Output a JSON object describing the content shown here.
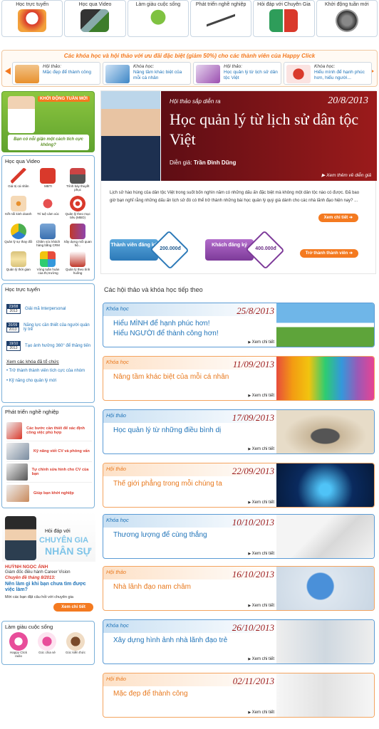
{
  "topnav": [
    {
      "label": "Học trực tuyến",
      "icon": "elearning-icon",
      "color": "#d9392b"
    },
    {
      "label": "Học qua Video",
      "icon": "video-icon",
      "color": "#6b7f8c"
    },
    {
      "label": "Làm giàu cuộc sống",
      "icon": "plant-icon",
      "color": "#6bb23a"
    },
    {
      "label": "Phát triển nghề nghiệp",
      "icon": "stairs-icon",
      "color": "#888888"
    },
    {
      "label": "Hỏi đáp với Chuyên Gia",
      "icon": "qa-icon",
      "color": "#2e9d5a"
    },
    {
      "label": "Khởi động tuần mới",
      "icon": "start-button-icon",
      "color": "#555555"
    }
  ],
  "promo": {
    "heading": "Các khóa học và hội thảo với ưu đãi đặc biệt (giảm 50%) cho các thành viên của Happy Click",
    "items": [
      {
        "type": "Hội thảo:",
        "desc": "Mặc đẹp để thành công",
        "color": "#e8902d"
      },
      {
        "type": "Khóa học:",
        "desc": "Nâng tầm khác biệt của mỗi cá nhân",
        "color": "#3d86c6"
      },
      {
        "type": "Hội thảo:",
        "desc": "Học quản lý từ lịch sử dân tộc Việt",
        "color": "#9b4fb0"
      },
      {
        "type": "Khóa học:",
        "desc": "Hiểu mình để hạnh phúc hơn, hiểu người...",
        "color": "#d9392b"
      }
    ]
  },
  "weekstart": {
    "label": "KHỞI ĐỘNG TUẦN MỚI",
    "text": "Bạn có nỗi giận một cách tích cực không?"
  },
  "video": {
    "title": "Học qua Video",
    "items": [
      "Giá trị cá nhân",
      "MBTI",
      "Trình bày thuyết phục",
      "Kết nối kinh doanh",
      "Trí tuệ cảm xúc",
      "Quản lý theo mục tiêu (MBO)",
      "Quản lý sự thay đổi",
      "Chăm sóc khách hàng bằng CRM",
      "Xây dựng mối quan hệ...",
      "Quản lý thời gian",
      "Vòng tuần hoàn của thị trường",
      "Quản lý theo tình huống"
    ]
  },
  "online": {
    "title": "Học trực tuyến",
    "items": [
      {
        "date": "23/08",
        "year": "2013",
        "text": "Giải mã Interpersonal"
      },
      {
        "date": "20/09",
        "year": "2013",
        "text": "Năng lực cần thiết của người quản lý trẻ"
      },
      {
        "date": "19/10",
        "year": "2013",
        "text": "Tạo ảnh hưởng 360° để thăng tiến"
      }
    ],
    "organized_title": "Xem các khóa đã tổ chức",
    "organized": [
      "Trở thành thành viên tích cực của nhóm",
      "Kỹ năng cho quản lý mới"
    ]
  },
  "career": {
    "title": "Phát triển nghề nghiệp",
    "items": [
      "Các bước cần thiết để xác định công việc phù hợp",
      "Kỹ năng viết CV và phỏng vấn",
      "Tự chỉnh sửa hình cho CV của bạn",
      "Giúp bạn khởi nghiệp"
    ]
  },
  "expert": {
    "ask": "Hỏi đáp với",
    "big1": "CHUYÊN GIA",
    "big2": "NHÂN SỰ",
    "name": "HUỲNH NGỌC ÁNH",
    "role": "Giám đốc điều hành Career Vision",
    "topic_label": "Chuyên đề tháng 8/2013:",
    "topic": "Nên làm gì khi bạn chưa tìm được việc làm?",
    "invite": "Mời các bạn đặt câu hỏi với chuyên gia",
    "button": "Xem chi tiết"
  },
  "life": {
    "title": "Làm giàu cuộc sống",
    "items": [
      "Happy Click radio",
      "Góc chia sẻ",
      "Góc kiến thức"
    ]
  },
  "hero": {
    "label": "Hội thảo sắp diễn ra",
    "date": "20/8/2013",
    "title": "Học quản lý từ lịch sử dân tộc Việt",
    "speaker_label": "Diễn giả:",
    "speaker": "Trần Đình Dũng",
    "more": "Xem thêm về diễn giả",
    "desc": "Lịch sử hào hùng của dân tộc Việt trong suốt bốn nghìn năm có những dấu ấn đặc biệt mà không một dân tộc nào có được. Đã bao giờ bạn nghĩ rằng những dấu ấn lịch sử đó có thể trở thành những bài học quản lý quý giá dành cho các nhà lãnh đạo hiện nay? ...",
    "detail": "Xem chi tiết",
    "member_label": "Thành viên đăng ký",
    "member_price": "200.000đ",
    "guest_label": "Khách đăng ký",
    "guest_price": "400.000đ",
    "join": "Trở thành thành viên"
  },
  "upcoming_title": "Các hội thảo và khóa học tiếp theo",
  "events": [
    {
      "cat": "Khóa học",
      "date": "25/8/2013",
      "title": "Hiểu MÌNH để hạnh phúc hơn!\nHiểu NGƯỜI để thành công hơn!",
      "more": "Xem chi tiết",
      "style": "blue",
      "img": "mountain"
    },
    {
      "cat": "Khóa học",
      "date": "11/09/2013",
      "title": "Nâng tầm khác biệt của mỗi cá nhân",
      "more": "Xem chi tiết",
      "style": "orange",
      "img": "pencils"
    },
    {
      "cat": "Hội thảo",
      "date": "17/09/2013",
      "title": "Học quản lý từ những điều bình dị",
      "more": "Xem chi tiết",
      "style": "blue",
      "img": "stones"
    },
    {
      "cat": "Hội thảo",
      "date": "22/09/2013",
      "title": "Thế giới phẳng trong mỗi chúng ta",
      "more": "Xem chi tiết",
      "style": "orange",
      "img": "globe-network"
    },
    {
      "cat": "Khóa học",
      "date": "10/10/2013",
      "title": "Thương lượng để cùng thắng",
      "more": "Xem chi tiết",
      "style": "blue",
      "img": "handshake"
    },
    {
      "cat": "Hội thảo",
      "date": "16/10/2013",
      "title": "Nhà lãnh đạo nam châm",
      "more": "Xem chi tiết",
      "style": "orange",
      "img": "earth-hand"
    },
    {
      "cat": "Khóa học",
      "date": "26/10/2013",
      "title": "Xây dựng hình ảnh nhà lãnh đạo trẻ",
      "more": "Xem chi tiết",
      "style": "blue",
      "img": "team"
    },
    {
      "cat": "Hội thảo",
      "date": "02/11/2013",
      "title": "Mặc đẹp để thành công",
      "more": "Xem chi tiết",
      "style": "orange",
      "img": "business-women"
    }
  ]
}
